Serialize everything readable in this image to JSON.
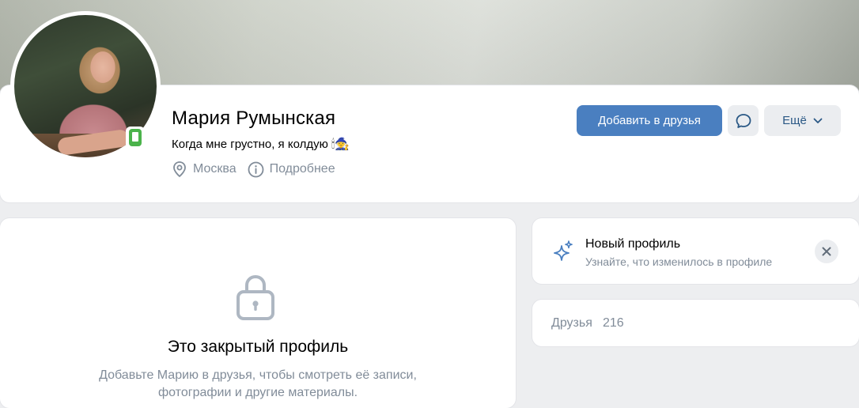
{
  "profile": {
    "name": "Мария Румынская",
    "status_text": "Когда мне грустно, я колдую",
    "status_emoji": "🕯🧙",
    "city": "Москва",
    "details_link": "Подробнее"
  },
  "actions": {
    "add_friend": "Добавить в друзья",
    "more": "Ещё"
  },
  "closed": {
    "title": "Это закрытый профиль",
    "description": "Добавьте Марию в друзья, чтобы смотреть её записи, фотографии и другие материалы."
  },
  "new_profile": {
    "title": "Новый профиль",
    "subtitle": "Узнайте, что изменилось в профиле"
  },
  "friends": {
    "label": "Друзья",
    "count": "216"
  },
  "colors": {
    "accent": "#4a7fc0",
    "online": "#4bb34b",
    "secondary_text": "#818c99",
    "page_bg": "#edeef0"
  }
}
